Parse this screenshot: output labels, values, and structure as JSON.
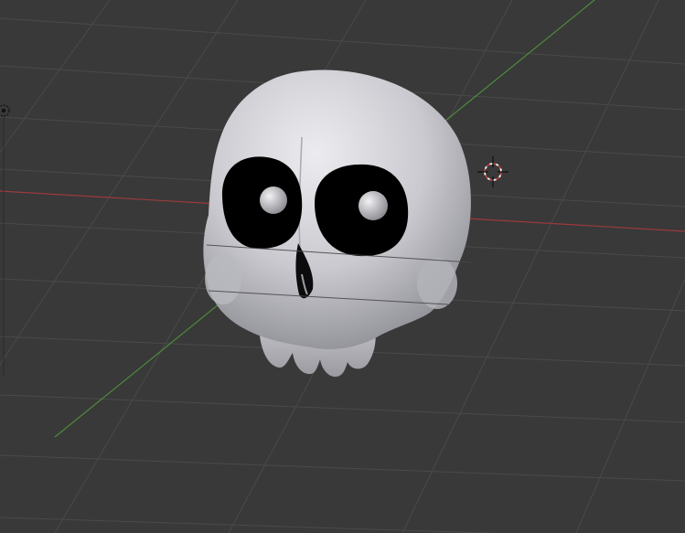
{
  "viewport": {
    "mode": "3D Viewport",
    "background_color": "#393939",
    "grid_line_color": "#4a4a4a",
    "x_axis_color": "#9b3a3a",
    "y_axis_color": "#4e8a3a",
    "cursor_color": "#c03a3a"
  },
  "scene": {
    "object": "skull-mesh",
    "shading": "solid",
    "object_color": "#c9c9cf",
    "eye_socket_color": "#000000"
  },
  "icons": {
    "cursor": "3d-cursor-icon",
    "light": "light-icon"
  }
}
